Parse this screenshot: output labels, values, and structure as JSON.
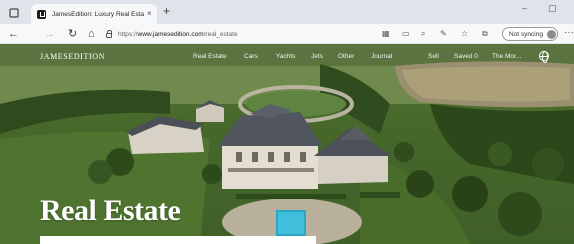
{
  "browser": {
    "tab_title": "JamesEdition: Luxury Real Estat",
    "tab_close": "×",
    "new_tab": "+",
    "url_prefix": "https://",
    "url_domain": "www.jamesedition.com",
    "url_path": "/real_estate",
    "sync_label": "Not syncing",
    "more": "···",
    "window_controls": [
      "–",
      "▢",
      "×"
    ]
  },
  "site": {
    "logo": "JAMESEDITION",
    "nav": [
      "Real Estate",
      "Cars",
      "Yachts",
      "Jets",
      "Other",
      "Journal",
      "Sell",
      "Saved 0",
      "The Mor..."
    ]
  },
  "hero": {
    "title": "Real Estate"
  }
}
